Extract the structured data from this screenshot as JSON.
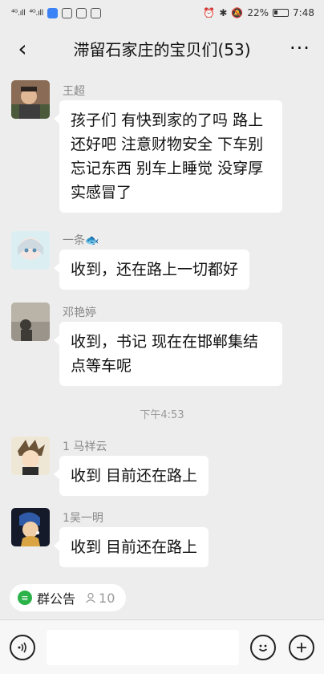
{
  "status_bar": {
    "signal1": "⁴ᴳ.ıll",
    "signal2": "⁴ᴳ.ıll",
    "battery_percent": "22%",
    "time": "7:48"
  },
  "header": {
    "back_icon": "‹",
    "title": "滞留石家庄的宝贝们(53)",
    "more_icon": "···"
  },
  "messages": [
    {
      "sender": "王超",
      "text": "孩子们 有快到家的了吗 路上还好吧 注意财物安全 下车别忘记东西 别车上睡觉 没穿厚实感冒了",
      "avatar_color": "#7a5a48"
    },
    {
      "sender": "一条🐟",
      "text": "收到，还在路上一切都好",
      "avatar_color": "#cfe6ee"
    },
    {
      "sender": "邓艳婷",
      "text": "收到，书记 现在在邯郸集结点等车呢",
      "avatar_color": "#6f6a63"
    },
    {
      "sender": "1 马祥云",
      "text": "收到   目前还在路上",
      "avatar_color": "#d8c6a8"
    },
    {
      "sender": "1吴一明",
      "text": "收到   目前还在路上",
      "avatar_color": "#1e3160"
    }
  ],
  "timestamp": "下午4:53",
  "announcement": {
    "label": "群公告",
    "count": "10"
  },
  "input_bar": {
    "voice_icon": "voice-icon",
    "emoji_icon": "emoji-icon",
    "plus_icon": "plus-icon"
  },
  "colors": {
    "background": "#ededed",
    "bubble": "#ffffff",
    "announce_green": "#2bb34a"
  }
}
